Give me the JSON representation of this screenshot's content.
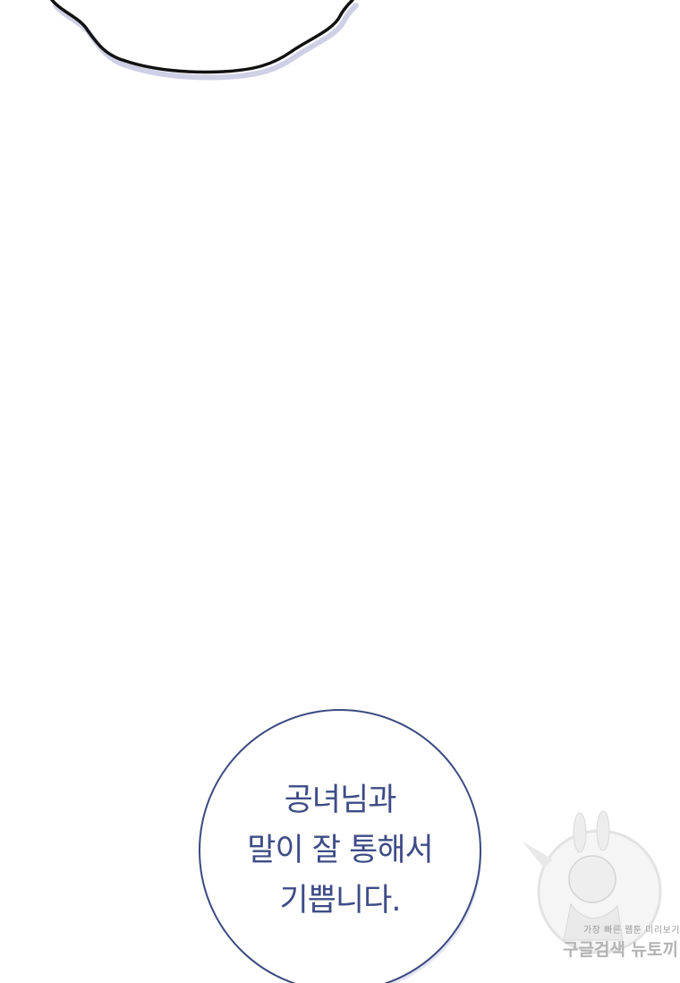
{
  "speech_bubble": {
    "lines": [
      "공녀님과",
      "말이 잘 통해서",
      "기쁩니다."
    ]
  },
  "watermark": {
    "tagline": "가장 빠른 웹툰 미리보기",
    "brand": "구글검색 뉴토끼"
  },
  "colors": {
    "bubble_outline": "#3a4a80",
    "bubble_text": "#3e4c86",
    "ink": "#111111",
    "watermark": "#b3b3b3"
  }
}
